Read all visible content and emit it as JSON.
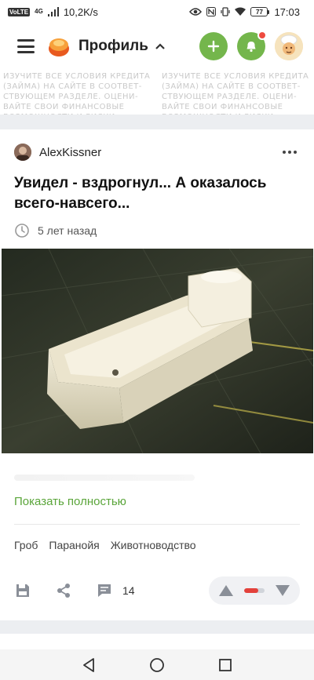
{
  "status_bar": {
    "volte": "VoLTE",
    "network_type": "4G",
    "speed": "10,2K/s",
    "battery": "77",
    "time": "17:03"
  },
  "header": {
    "title": "Профиль"
  },
  "ad_banner": {
    "text": "ИЗУЧИТЕ ВСЕ УСЛОВИЯ КРЕДИТА (ЗАЙМА) НА САЙТЕ В СООТВЕТ-СТВУЮЩЕМ РАЗДЕЛЕ. ОЦЕНИ-ВАЙТЕ СВОИ ФИНАНСОВЫЕ ВОЗМОЖНОСТИ И РИСКИ"
  },
  "post": {
    "author": "AlexKissner",
    "title": "Увидел - вздрогнул... А оказалось всего-навсего...",
    "time": "5 лет назад",
    "show_full": "Показать полностью",
    "tags": [
      "Гроб",
      "Паранойя",
      "Животноводство"
    ],
    "comment_count": "14",
    "rating_fraction": 0.7
  },
  "colors": {
    "accent_green": "#74b64c",
    "link_green": "#5aa53a",
    "notification_red": "#ee4b3f",
    "rating_red": "#e3413b"
  }
}
